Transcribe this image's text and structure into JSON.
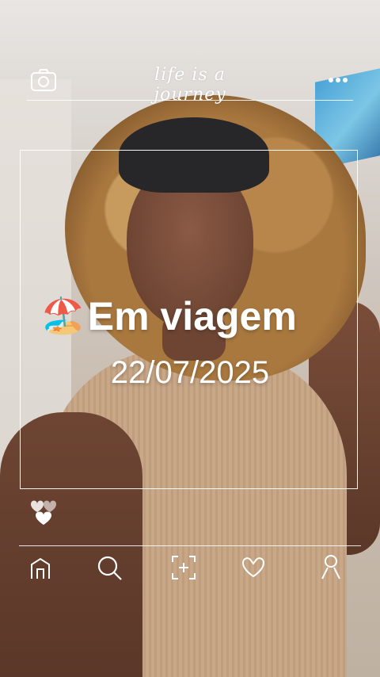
{
  "header": {
    "tagline": "life is a journey",
    "camera_icon": "camera-icon",
    "more_icon": "more-dots-icon"
  },
  "card": {
    "emoji": "🏖️",
    "status": "Em viagem",
    "date": "22/07/2025"
  },
  "reactions": {
    "icon": "double-heart-icon"
  },
  "nav": {
    "items": [
      {
        "name": "home",
        "icon": "home-icon"
      },
      {
        "name": "search",
        "icon": "search-icon"
      },
      {
        "name": "add",
        "icon": "add-square-icon"
      },
      {
        "name": "likes",
        "icon": "heart-icon"
      },
      {
        "name": "profile",
        "icon": "profile-icon"
      }
    ]
  }
}
